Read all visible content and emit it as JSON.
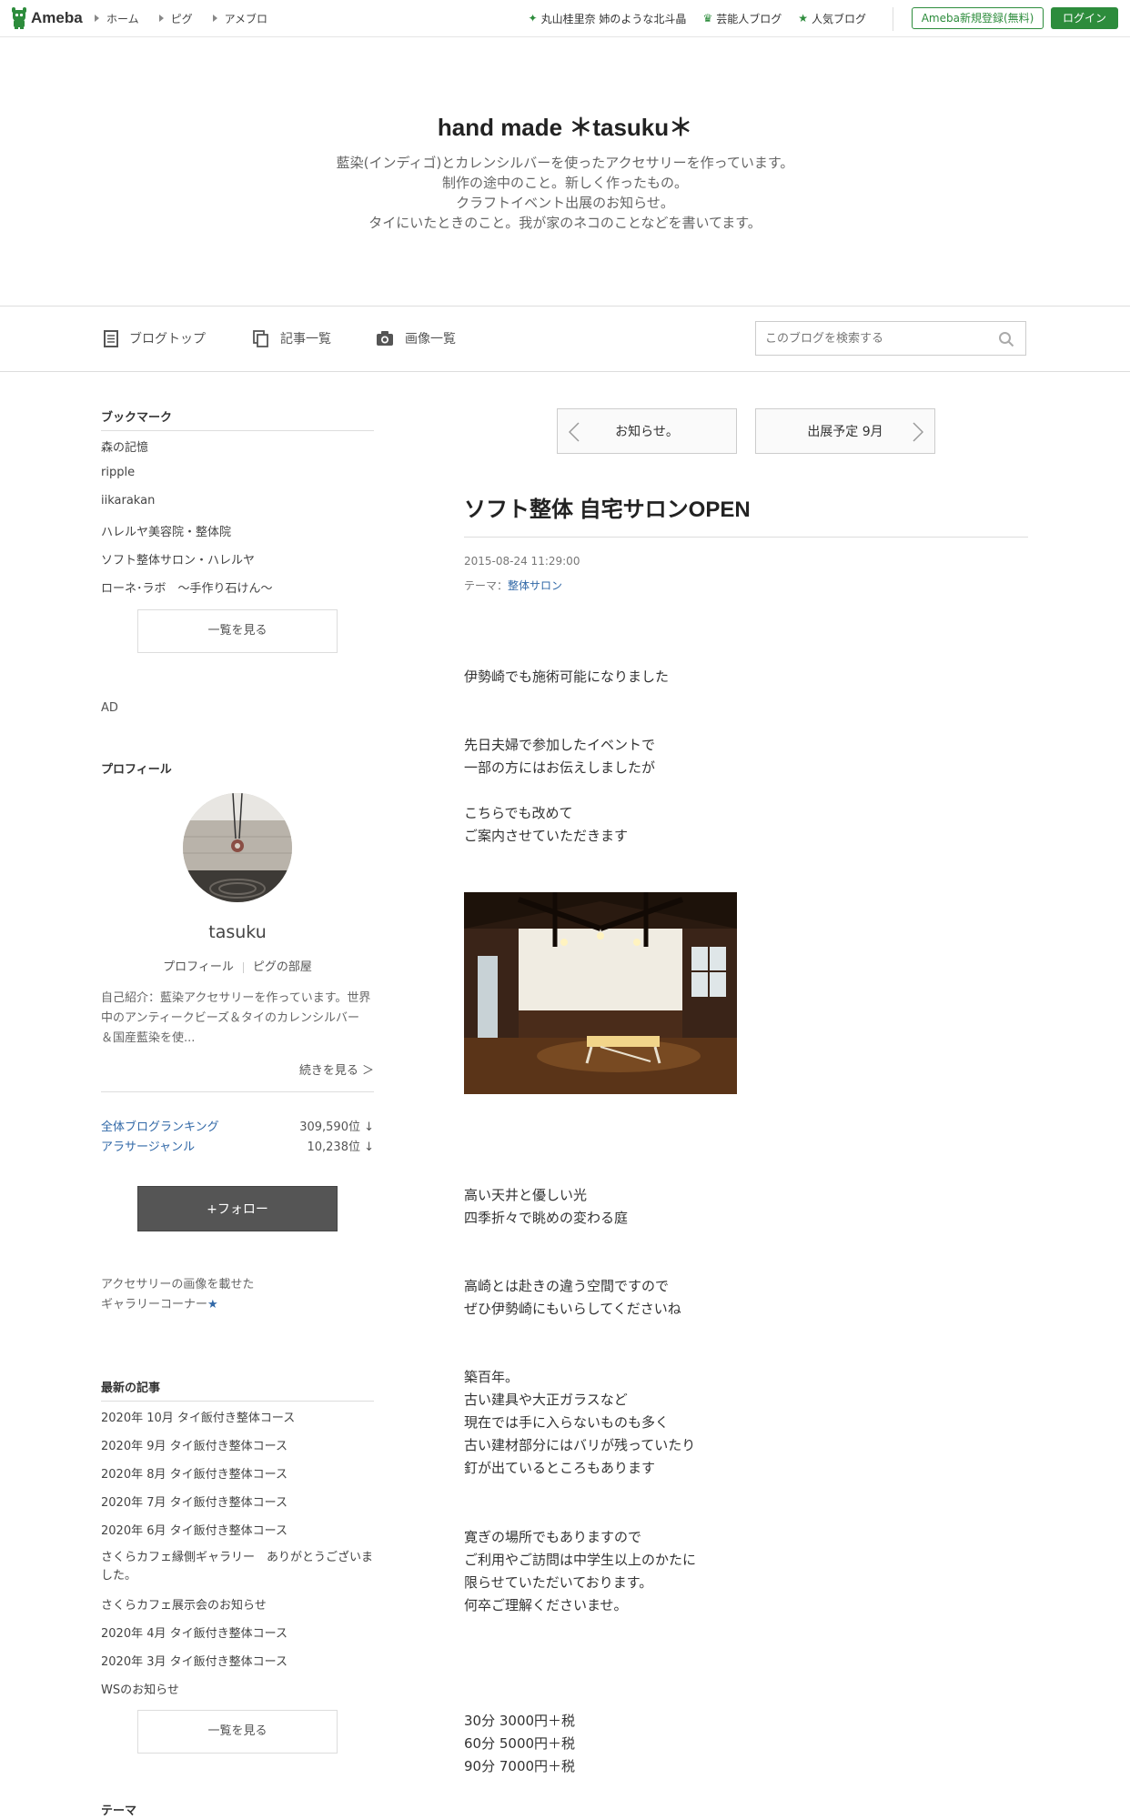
{
  "global_header": {
    "logo_text": "Ameba",
    "breadcrumbs": [
      "ホーム",
      "ピグ",
      "アメブロ"
    ],
    "links": [
      "丸山桂里奈 姉のような北斗晶",
      "芸能人ブログ",
      "人気ブログ"
    ],
    "register_label": "Ameba新規登録(無料)",
    "login_label": "ログイン"
  },
  "blog_header": {
    "title": "hand made ＊tasuku＊",
    "description": [
      "藍染(インディゴ)とカレンシルバーを使ったアクセサリーを作っています。",
      "制作の途中のこと。新しく作ったもの。",
      "クラフトイベント出展のお知らせ。",
      "タイにいたときのこと。我が家のネコのことなどを書いてます。"
    ]
  },
  "blog_nav": {
    "items": [
      "ブログトップ",
      "記事一覧",
      "画像一覧"
    ],
    "search_placeholder": "このブログを検索する"
  },
  "sidebar": {
    "bookmark": {
      "title": "ブックマーク",
      "items": [
        "森の記憶",
        "ripple",
        "iikarakan",
        "ハレルヤ美容院・整体院",
        "ソフト整体サロン・ハレルヤ",
        "ローネ･ラボ　～手作り石けん～"
      ],
      "more_label": "一覧を見る"
    },
    "ad_label": "AD",
    "profile": {
      "title": "プロフィール",
      "name": "tasuku",
      "link_profile": "プロフィール",
      "link_room": "ピグの部屋",
      "intro": "自己紹介：藍染アクセサリーを作っています。世界中のアンティークビーズ＆タイのカレンシルバー ＆国産藍染を使...",
      "continue_label": "続きを見る ＞",
      "rankings": [
        {
          "label": "全体ブログランキング",
          "value": "309,590位 ↓"
        },
        {
          "label": "アラサージャンル",
          "value": "10,238位 ↓"
        }
      ],
      "follow_label": "+フォロー",
      "gallery_line1": "アクセサリーの画像を載せた",
      "gallery_line2": "ギャラリーコーナー",
      "gallery_star": "★"
    },
    "recent": {
      "title": "最新の記事",
      "items": [
        "2020年 10月 タイ飯付き整体コース",
        "2020年 9月 タイ飯付き整体コース",
        "2020年 8月 タイ飯付き整体コース",
        "2020年 7月 タイ飯付き整体コース",
        "2020年 6月 タイ飯付き整体コース",
        "さくらカフェ縁側ギャラリー　ありがとうございました。",
        "さくらカフェ展示会のお知らせ",
        "2020年 4月 タイ飯付き整体コース",
        "2020年 3月 タイ飯付き整体コース",
        "WSのお知らせ"
      ],
      "more_label": "一覧を見る"
    },
    "theme_title": "テーマ"
  },
  "article": {
    "prev_label": "お知らせ。",
    "next_label": "出展予定 9月",
    "title": "ソフト整体 自宅サロンOPEN",
    "date": "2015-08-24 11:29:00",
    "theme_prefix": "テーマ：",
    "theme": "整体サロン",
    "paragraphs": [
      "伊勢崎でも施術可能になりました",
      "先日夫婦で参加したイベントで\n一部の方にはお伝えしましたが",
      "こちらでも改めて\nご案内させていただきます",
      "高い天井と優しい光\n四季折々で眺めの変わる庭",
      "高崎とは赴きの違う空間ですので\nぜひ伊勢崎にもいらしてくださいね",
      "築百年。\n古い建具や大正ガラスなど\n現在では手に入らないものも多く\n古い建材部分にはバリが残っていたり\n釘が出ているところもあります",
      "寛ぎの場所でもありますので\nご利用やご訪問は中学生以上のかたに\n限らせていただいております。\n何卒ご理解くださいませ。",
      "30分 3000円＋税\n60分 5000円＋税\n90分 7000円＋税"
    ]
  }
}
